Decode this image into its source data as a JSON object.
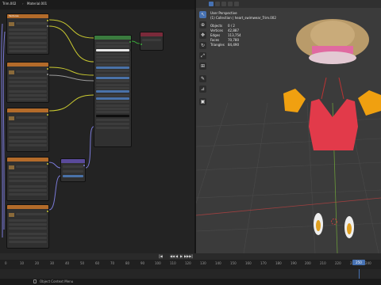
{
  "node_editor": {
    "tabs": [
      "Trim.002",
      "Material.001"
    ],
    "node_header": "Textures"
  },
  "viewport": {
    "mode": "User Perspective",
    "collection": "(1) Collection | heart_swimwear_Trim.002",
    "stats": [
      {
        "label": "Objects",
        "value": "0 / 2"
      },
      {
        "label": "Vertices",
        "value": "42,887"
      },
      {
        "label": "Edges",
        "value": "113,754"
      },
      {
        "label": "Faces",
        "value": "70,780"
      },
      {
        "label": "Triangles",
        "value": "84,490"
      }
    ]
  },
  "timeline": {
    "ticks": [
      "0",
      "10",
      "20",
      "30",
      "40",
      "50",
      "60",
      "70",
      "80",
      "90",
      "100",
      "110",
      "120",
      "130",
      "140",
      "150",
      "160",
      "170",
      "180",
      "190",
      "200",
      "210",
      "220",
      "230",
      "240"
    ],
    "current_frame": "250",
    "playback_glyphs": [
      "|◀",
      "◀◀",
      "◀",
      "▶",
      "▶▶",
      "▶|"
    ]
  },
  "status_bar": {
    "text": "Object Context Menu"
  },
  "colors": {
    "accent": "#4772b3",
    "texture_header": "#b36b2a",
    "principled_header": "#3a7b3e",
    "output_header": "#7a2a3a",
    "wire_yellow": "#c8c830",
    "wire_purple": "#7a7ad8",
    "wire_gray": "#9a9a9a"
  },
  "icons": [
    "select-icon",
    "cursor-icon",
    "move-icon",
    "rotate-icon",
    "scale-icon",
    "transform-icon",
    "annotate-icon",
    "measure-icon",
    "add-cube-icon",
    "play-icon"
  ]
}
